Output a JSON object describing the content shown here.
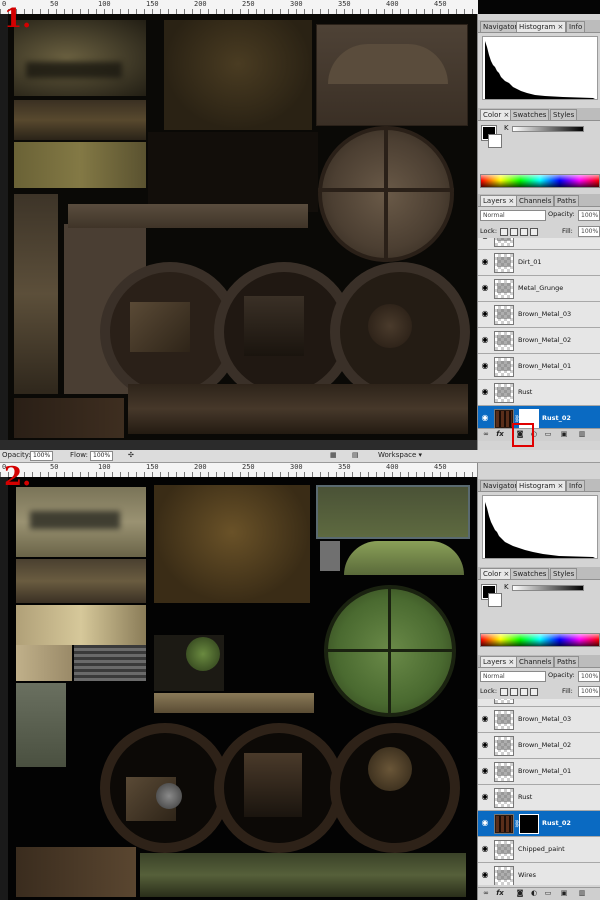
{
  "screens": [
    {
      "step_label": "1.",
      "ruler_labels": [
        "0",
        "50",
        "100",
        "150",
        "200",
        "250",
        "300",
        "350",
        "400",
        "450"
      ],
      "panel": {
        "info_tabs": [
          "Navigator",
          "Histogram ×",
          "Info"
        ],
        "color_tabs": [
          "Color ×",
          "Swatches",
          "Styles"
        ],
        "color_channel": "K",
        "layers_tabs": [
          "Layers ×",
          "Channels",
          "Paths"
        ],
        "blend_mode": "Normal",
        "opacity_label": "Opacity:",
        "opacity_value": "100%",
        "lock_label": "Lock:",
        "fill_label": "Fill:",
        "fill_value": "100%",
        "layers": [
          {
            "name": "Dirt_01",
            "selected": false
          },
          {
            "name": "Metal_Grunge",
            "selected": false
          },
          {
            "name": "Brown_Metal_03",
            "selected": false
          },
          {
            "name": "Brown_Metal_02",
            "selected": false
          },
          {
            "name": "Brown_Metal_01",
            "selected": false
          },
          {
            "name": "Rust",
            "selected": false
          },
          {
            "name": "Rust_02",
            "selected": true
          }
        ]
      }
    },
    {
      "step_label": "2.",
      "options_bar": {
        "opacity_label": "Opacity:",
        "opacity_value": "100%",
        "flow_label": "Flow:",
        "flow_value": "100%",
        "workspace_label": "Workspace ▾"
      },
      "ruler_labels": [
        "0",
        "50",
        "100",
        "150",
        "200",
        "250",
        "300",
        "350",
        "400",
        "450"
      ],
      "panel": {
        "info_tabs": [
          "Navigator",
          "Histogram ×",
          "Info"
        ],
        "color_tabs": [
          "Color ×",
          "Swatches",
          "Styles"
        ],
        "color_channel": "K",
        "layers_tabs": [
          "Layers ×",
          "Channels",
          "Paths"
        ],
        "blend_mode": "Normal",
        "opacity_label": "Opacity:",
        "opacity_value": "100%",
        "lock_label": "Lock:",
        "fill_label": "Fill:",
        "fill_value": "100%",
        "layers": [
          {
            "name": "Brown_Metal_03",
            "selected": false
          },
          {
            "name": "Brown_Metal_02",
            "selected": false
          },
          {
            "name": "Brown_Metal_01",
            "selected": false
          },
          {
            "name": "Rust",
            "selected": false
          },
          {
            "name": "Rust_02",
            "selected": true
          },
          {
            "name": "Chipped_paint",
            "selected": false
          },
          {
            "name": "Wires",
            "selected": false
          }
        ]
      }
    }
  ],
  "colors": {
    "selection_blue": "#0a6ac2",
    "highlight_red": "#e00000",
    "step_label_red": "#d40000"
  },
  "icons": [
    "eye-icon",
    "chain-link-icon",
    "fx-icon",
    "add-mask-icon",
    "adjustment-layer-icon",
    "folder-icon",
    "new-layer-icon",
    "trash-icon"
  ]
}
